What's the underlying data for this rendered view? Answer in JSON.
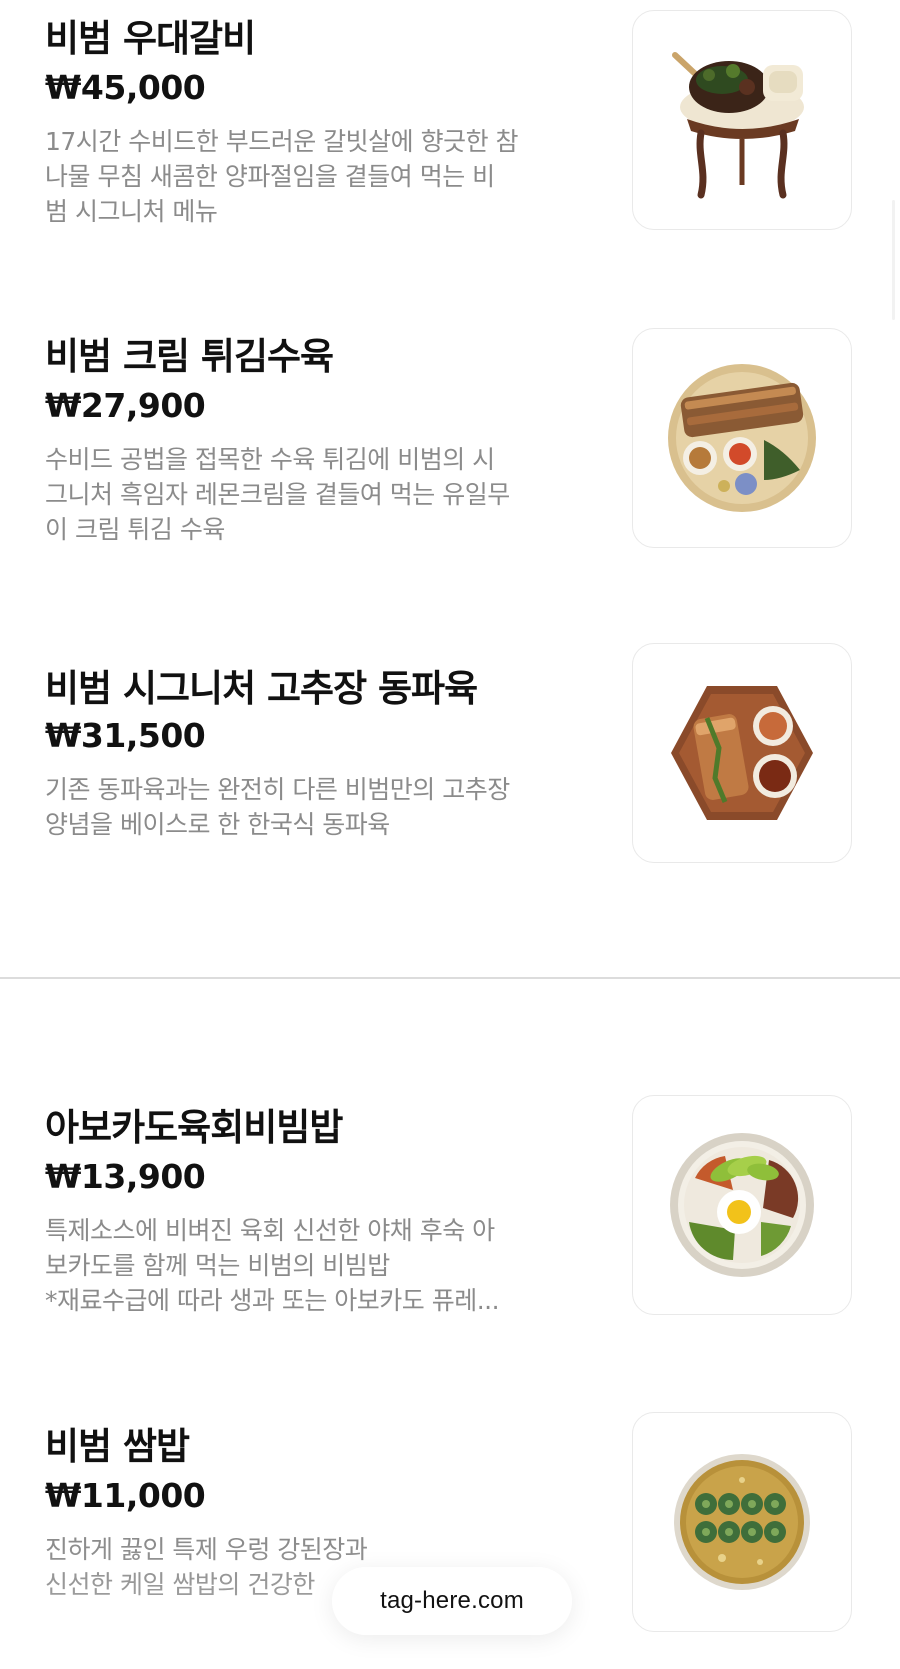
{
  "menu_items": [
    {
      "name": "비범 우대갈비",
      "price": "₩45,000",
      "description": [
        "17시간 수비드한 부드러운 갈빗살에 향긋한 참",
        "나물 무침 새콤한 양파절임을 곁들여 먹는 비",
        "범 시그니처 메뉴"
      ],
      "image_icon": "galbi-platter-image"
    },
    {
      "name": "비범 크림 튀김수육",
      "price": "₩27,900",
      "description": [
        "수비드 공법을 접목한 수육 튀김에 비범의 시",
        "그니처 흑임자 레몬크림을 곁들여 먹는 유일무",
        "이 크림 튀김 수육"
      ],
      "image_icon": "fried-suyuk-platter-image"
    },
    {
      "name": "비범 시그니처 고추장 동파육",
      "price": "₩31,500",
      "description": [
        "기존 동파육과는 완전히 다른 비범만의 고추장",
        "양념을 베이스로 한 한국식 동파육"
      ],
      "image_icon": "dongpayuk-plate-image"
    },
    {
      "name": "아보카도육회비빔밥",
      "price": "₩13,900",
      "description": [
        "특제소스에 비벼진 육회 신선한 야채 후숙 아",
        "보카도를 함께 먹는 비범의 비빔밥",
        "*재료수급에 따라 생과 또는 아보카도 퓨레..."
      ],
      "image_icon": "avocado-bibimbap-bowl-image"
    },
    {
      "name": "비범 쌈밥",
      "price": "₩11,000",
      "description": [
        "진하게 끓인 특제 우렁 강된장과",
        "신선한 케일 쌈밥의 건강한"
      ],
      "image_icon": "ssambap-bowl-image"
    }
  ],
  "footer": {
    "site_label": "tag-here.com"
  },
  "colors": {
    "text_primary": "#111111",
    "text_secondary": "#8b8b8b",
    "card_border": "#e9e9e9",
    "divider": "#dcdcdc",
    "background": "#ffffff"
  }
}
